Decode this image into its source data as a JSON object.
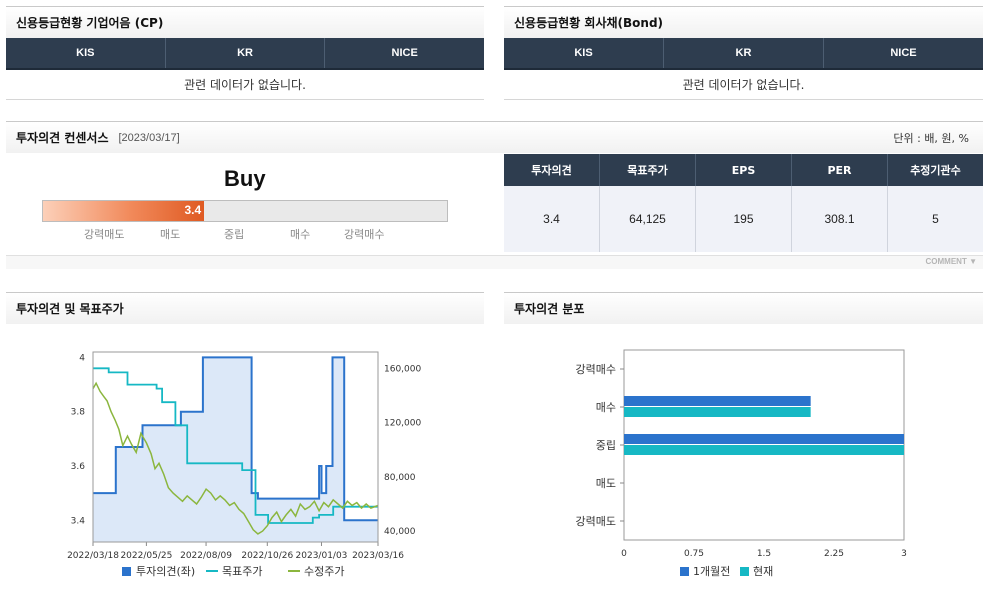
{
  "credit_cp": {
    "title": "신용등급현황 기업어음 (CP)",
    "columns": [
      "KIS",
      "KR",
      "NICE"
    ],
    "empty_message": "관련 데이터가 없습니다."
  },
  "credit_bond": {
    "title": "신용등급현황 회사채(Bond)",
    "columns": [
      "KIS",
      "KR",
      "NICE"
    ],
    "empty_message": "관련 데이터가 없습니다."
  },
  "consensus": {
    "title": "투자의견 컨센서스",
    "date": "[2023/03/17]",
    "unit": "단위 : 배, 원, %",
    "gauge": {
      "label": "Buy",
      "value": "3.4",
      "level": 3.4,
      "scale_labels": [
        "강력매도",
        "매도",
        "중립",
        "매수",
        "강력매수"
      ]
    },
    "columns": [
      "투자의견",
      "목표주가",
      "EPS",
      "PER",
      "추정기관수"
    ],
    "values": [
      "3.4",
      "64,125",
      "195",
      "308.1",
      "5"
    ],
    "comment_label": "COMMENT"
  },
  "colors": {
    "header_dark": "#2e3d4f",
    "opinion_blue": "#2b73cc",
    "target_teal": "#16b8c4",
    "price_green": "#8bb63e",
    "gauge_orange": "#df5a22"
  },
  "chart_data": [
    {
      "type": "line",
      "title": "투자의견 및 목표주가",
      "x_ticks": [
        "2022/03/18",
        "2022/05/25",
        "2022/08/09",
        "2022/10/26",
        "2023/01/03",
        "2023/03/16"
      ],
      "y_left_ticks": [
        "3.4",
        "3.6",
        "3.8",
        "4"
      ],
      "y_left_range": [
        3.32,
        4.02
      ],
      "y_right_ticks": [
        "40,000",
        "80,000",
        "120,000",
        "160,000"
      ],
      "y_right_range": [
        32000,
        172000
      ],
      "legend": [
        "투자의견(좌)",
        "목표주가",
        "수정주가"
      ],
      "series": [
        {
          "name": "투자의견(좌)",
          "axis": "left",
          "style": "area-step",
          "x": [
            "2022/03/18",
            "2022/04/16",
            "2022/04/16",
            "2022/05/20",
            "2022/05/20",
            "2022/07/08",
            "2022/07/08",
            "2022/08/05",
            "2022/08/05",
            "2022/10/06",
            "2022/10/06",
            "2022/10/14",
            "2022/10/14",
            "2022/12/31",
            "2022/12/31",
            "2023/01/03",
            "2023/01/03",
            "2023/01/09",
            "2023/01/09",
            "2023/01/17",
            "2023/01/17",
            "2023/02/01",
            "2023/02/01",
            "2023/03/16"
          ],
          "values": [
            3.5,
            3.5,
            3.67,
            3.67,
            3.75,
            3.75,
            3.8,
            3.8,
            4.0,
            4.0,
            3.5,
            3.5,
            3.48,
            3.48,
            3.6,
            3.6,
            3.5,
            3.5,
            3.6,
            3.6,
            4.0,
            4.0,
            3.4,
            3.4
          ]
        },
        {
          "name": "목표주가",
          "axis": "right",
          "style": "step",
          "x": [
            "2022/03/18",
            "2022/04/07",
            "2022/04/07",
            "2022/05/01",
            "2022/05/01",
            "2022/06/07",
            "2022/06/07",
            "2022/06/14",
            "2022/06/14",
            "2022/07/01",
            "2022/07/01",
            "2022/07/16",
            "2022/07/16",
            "2022/09/24",
            "2022/09/24",
            "2022/10/11",
            "2022/10/11",
            "2022/10/27",
            "2022/10/27",
            "2022/12/23",
            "2022/12/23",
            "2022/12/31",
            "2022/12/31",
            "2023/01/18",
            "2023/01/18",
            "2023/03/16"
          ],
          "values": [
            160000,
            160000,
            157000,
            157000,
            148000,
            148000,
            145000,
            145000,
            135000,
            135000,
            118000,
            118000,
            90000,
            90000,
            85000,
            85000,
            52000,
            52000,
            46000,
            46000,
            50000,
            50000,
            52000,
            52000,
            58000,
            58000
          ]
        },
        {
          "name": "수정주가",
          "axis": "right",
          "style": "line",
          "x": [
            "2022/03/18",
            "2022/03/22",
            "2022/03/27",
            "2022/04/01",
            "2022/04/05",
            "2022/04/10",
            "2022/04/15",
            "2022/04/20",
            "2022/04/25",
            "2022/05/01",
            "2022/05/06",
            "2022/05/12",
            "2022/05/18",
            "2022/05/25",
            "2022/05/31",
            "2022/06/05",
            "2022/06/10",
            "2022/06/16",
            "2022/06/22",
            "2022/06/28",
            "2022/07/04",
            "2022/07/10",
            "2022/07/16",
            "2022/07/22",
            "2022/07/28",
            "2022/08/03",
            "2022/08/09",
            "2022/08/15",
            "2022/08/21",
            "2022/08/27",
            "2022/09/02",
            "2022/09/08",
            "2022/09/14",
            "2022/09/20",
            "2022/09/26",
            "2022/10/02",
            "2022/10/08",
            "2022/10/14",
            "2022/10/20",
            "2022/10/26",
            "2022/11/01",
            "2022/11/07",
            "2022/11/13",
            "2022/11/19",
            "2022/11/25",
            "2022/12/01",
            "2022/12/07",
            "2022/12/13",
            "2022/12/19",
            "2022/12/25",
            "2022/12/31",
            "2023/01/06",
            "2023/01/12",
            "2023/01/18",
            "2023/01/24",
            "2023/01/30",
            "2023/02/05",
            "2023/02/11",
            "2023/02/17",
            "2023/02/23",
            "2023/03/01",
            "2023/03/07",
            "2023/03/16"
          ],
          "values": [
            145000,
            149000,
            143000,
            139000,
            136000,
            128000,
            122000,
            115000,
            103000,
            110000,
            104000,
            98000,
            112000,
            105000,
            97000,
            86000,
            90000,
            82000,
            72000,
            68000,
            65000,
            62000,
            66000,
            63000,
            60000,
            65000,
            71000,
            68000,
            63000,
            66000,
            63000,
            59000,
            61000,
            56000,
            53000,
            47000,
            41000,
            38000,
            40000,
            44000,
            50000,
            54000,
            47000,
            52000,
            56000,
            51000,
            60000,
            56000,
            58000,
            62000,
            55000,
            61000,
            58000,
            63000,
            60000,
            57000,
            62000,
            59000,
            61000,
            57000,
            60000,
            57000,
            59000
          ]
        }
      ]
    },
    {
      "type": "bar",
      "orientation": "horizontal",
      "title": "투자의견 분포",
      "categories": [
        "강력매수",
        "매수",
        "중립",
        "매도",
        "강력매도"
      ],
      "x_ticks": [
        "0",
        "0.75",
        "1.5",
        "2.25",
        "3"
      ],
      "x_range": [
        0,
        3
      ],
      "series": [
        {
          "name": "1개월전",
          "values": [
            0,
            2,
            3,
            0,
            0
          ]
        },
        {
          "name": "현재",
          "values": [
            0,
            2,
            3,
            0,
            0
          ]
        }
      ]
    }
  ]
}
